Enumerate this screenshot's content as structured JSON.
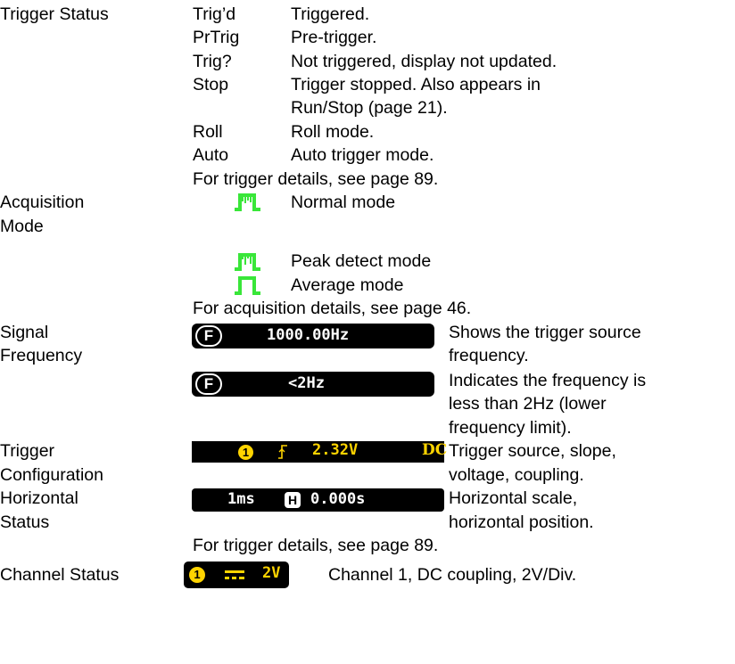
{
  "trigger_status": {
    "label": "Trigger Status",
    "items": [
      {
        "code": "Trig’d",
        "desc": "Triggered."
      },
      {
        "code": "PrTrig",
        "desc": "Pre-trigger."
      },
      {
        "code": "Trig?",
        "desc": "Not triggered, display not updated."
      },
      {
        "code": "Stop",
        "desc": "Trigger stopped. Also appears in"
      },
      {
        "code": "",
        "desc": "Run/Stop (page 21)."
      },
      {
        "code": "Roll",
        "desc": "Roll mode."
      },
      {
        "code": "Auto",
        "desc": "Auto trigger mode."
      }
    ],
    "note": "For trigger details, see page 89."
  },
  "acquisition": {
    "label_1": "Acquisition",
    "label_2": "Mode",
    "items": [
      {
        "icon": "normal-mode-icon",
        "desc": "Normal mode"
      },
      {
        "icon": "peak-detect-mode-icon",
        "desc": "Peak detect mode"
      },
      {
        "icon": "average-mode-icon",
        "desc": "Average mode"
      }
    ],
    "note": "For acquisition details, see page 46.",
    "icon_color": "#39e639"
  },
  "signal_frequency": {
    "label_1": "Signal",
    "label_2": "Frequency",
    "badge": "F",
    "rows": [
      {
        "value": "1000.00Hz",
        "desc_1": "Shows the trigger source",
        "desc_2": "frequency."
      },
      {
        "value": "<2Hz",
        "desc_1": "Indicates the frequency is",
        "desc_2": "less than 2Hz (lower",
        "desc_3": "frequency limit)."
      }
    ]
  },
  "trigger_config": {
    "label_1": "Trigger",
    "label_2": "Configuration",
    "channel": "1",
    "voltage": "2.32V",
    "coupling": "DC",
    "desc_1": "Trigger source, slope,",
    "desc_2": "voltage, coupling.",
    "accent_color": "#ffd400"
  },
  "horizontal": {
    "label_1": "Horizontal",
    "label_2": "Status",
    "scale": "1ms",
    "badge": "H",
    "position": "0.000s",
    "desc_1": "Horizontal scale,",
    "desc_2": "horizontal position.",
    "note": "For trigger details, see page 89."
  },
  "channel_status": {
    "label": "Channel Status",
    "channel": "1",
    "volts": "2V",
    "desc": "Channel 1, DC coupling, 2V/Div."
  }
}
